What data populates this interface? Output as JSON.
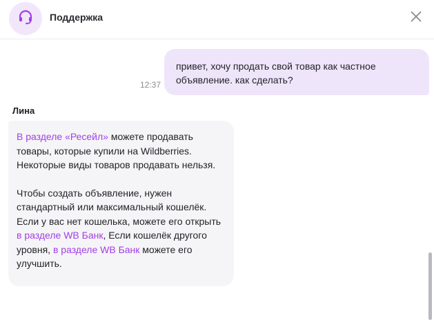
{
  "header": {
    "title": "Поддержка",
    "avatar_icon": "headset-icon",
    "close_icon": "close-icon",
    "accent_color": "#a23ee6"
  },
  "messages": [
    {
      "direction": "outgoing",
      "text_line1": "привет, хочу продать свой товар как частное",
      "text_line2": "объявление. как сделать?",
      "time": "12:37"
    },
    {
      "direction": "incoming",
      "sender": "Лина",
      "p1": {
        "link": "В разделе «Ресейл»",
        "text_a": " можете продавать",
        "line2": "товары, которые купили на Wildberries.",
        "line3": "Некоторые виды товаров продавать нельзя."
      },
      "p2": {
        "line1": "Чтобы создать объявление, нужен",
        "line2": "стандартный или максимальный кошелёк.",
        "line3": "Если у вас нет кошелька, можете его открыть",
        "link1": "в разделе WB Банк",
        "text_b": ", Если кошелёк другого",
        "text_c": "уровня, ",
        "link2": "в разделе WB Банк",
        "text_d": " можете его",
        "line_last": "улучшить."
      }
    }
  ]
}
